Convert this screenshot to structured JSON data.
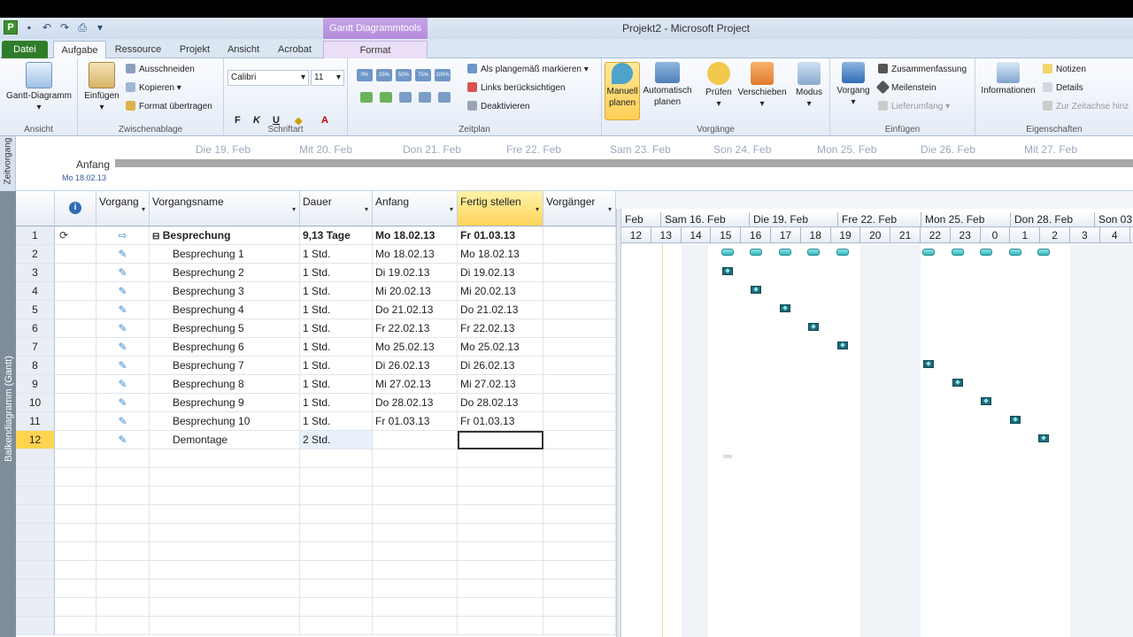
{
  "window": {
    "title": "Projekt2 - Microsoft Project",
    "contextual_tab_group": "Gantt Diagrammtools",
    "app_icon": "P"
  },
  "tabs": [
    "Datei",
    "Aufgabe",
    "Ressource",
    "Projekt",
    "Ansicht",
    "Acrobat",
    "Format"
  ],
  "ribbon": {
    "ansicht": {
      "button": "Gantt-Diagramm",
      "label": "Ansicht"
    },
    "zwischenablage": {
      "einfuegen": "Einfügen",
      "ausschneiden": "Ausschneiden",
      "kopieren": "Kopieren",
      "format": "Format übertragen",
      "label": "Zwischenablage"
    },
    "schriftart": {
      "font": "Calibri",
      "size": "11",
      "label": "Schriftart"
    },
    "zeitplan": {
      "markieren": "Als plangemäß markieren",
      "links": "Links berücksichtigen",
      "deaktivieren": "Deaktivieren",
      "label": "Zeitplan",
      "percent": [
        "0%",
        "25%",
        "50%",
        "75%",
        "100%"
      ]
    },
    "vorgaenge": {
      "manuell": "Manuell planen",
      "automatisch": "Automatisch planen",
      "pruefen": "Prüfen",
      "verschieben": "Verschieben",
      "modus": "Modus",
      "label": "Vorgänge"
    },
    "einfuegen": {
      "vorgang": "Vorgang",
      "zusammenfassung": "Zusammenfassung",
      "meilenstein": "Meilenstein",
      "lieferumfang": "Lieferumfang",
      "label": "Einfügen"
    },
    "eigenschaften": {
      "informationen": "Informationen",
      "notizen": "Notizen",
      "details": "Details",
      "zeitachse": "Zur Zeitachse hinz",
      "label": "Eigenschaften"
    }
  },
  "timeline": {
    "side_label": "Zeitvorgang",
    "dates": [
      "Die 19. Feb",
      "Mit 20. Feb",
      "Don 21. Feb",
      "Fre 22. Feb",
      "Sam 23. Feb",
      "Son 24. Feb",
      "Mon 25. Feb",
      "Die 26. Feb",
      "Mit 27. Feb"
    ],
    "start_label": "Anfang",
    "start_date": "Mo 18.02.13"
  },
  "view_label": "Balkendiagramm (Gantt)",
  "table": {
    "headers": {
      "info": "i",
      "mode": "Vorgang",
      "name": "Vorgangsname",
      "duration": "Dauer",
      "start": "Anfang",
      "finish": "Fertig stellen",
      "pred": "Vorgänger"
    },
    "rows": [
      {
        "id": "1",
        "name": "Besprechung",
        "duration": "9,13 Tage",
        "start": "Mo 18.02.13",
        "finish": "Fr 01.03.13"
      },
      {
        "id": "2",
        "name": "Besprechung 1",
        "duration": "1 Std.",
        "start": "Mo 18.02.13",
        "finish": "Mo 18.02.13"
      },
      {
        "id": "3",
        "name": "Besprechung 2",
        "duration": "1 Std.",
        "start": "Di 19.02.13",
        "finish": "Di 19.02.13"
      },
      {
        "id": "4",
        "name": "Besprechung 3",
        "duration": "1 Std.",
        "start": "Mi 20.02.13",
        "finish": "Mi 20.02.13"
      },
      {
        "id": "5",
        "name": "Besprechung 4",
        "duration": "1 Std.",
        "start": "Do 21.02.13",
        "finish": "Do 21.02.13"
      },
      {
        "id": "6",
        "name": "Besprechung 5",
        "duration": "1 Std.",
        "start": "Fr 22.02.13",
        "finish": "Fr 22.02.13"
      },
      {
        "id": "7",
        "name": "Besprechung 6",
        "duration": "1 Std.",
        "start": "Mo 25.02.13",
        "finish": "Mo 25.02.13"
      },
      {
        "id": "8",
        "name": "Besprechung 7",
        "duration": "1 Std.",
        "start": "Di 26.02.13",
        "finish": "Di 26.02.13"
      },
      {
        "id": "9",
        "name": "Besprechung 8",
        "duration": "1 Std.",
        "start": "Mi 27.02.13",
        "finish": "Mi 27.02.13"
      },
      {
        "id": "10",
        "name": "Besprechung 9",
        "duration": "1 Std.",
        "start": "Do 28.02.13",
        "finish": "Do 28.02.13"
      },
      {
        "id": "11",
        "name": "Besprechung 10",
        "duration": "1 Std.",
        "start": "Fr 01.03.13",
        "finish": "Fr 01.03.13"
      },
      {
        "id": "12",
        "name": "Demontage",
        "duration": "2 Std.",
        "start": "",
        "finish": ""
      }
    ]
  },
  "gantt": {
    "weeks": [
      "Feb",
      "Sam 16. Feb",
      "Die 19. Feb",
      "Fre 22. Feb",
      "Mon 25. Feb",
      "Don 28. Feb",
      "Son 03"
    ],
    "days": [
      "12",
      "13",
      "14",
      "15",
      "16",
      "17",
      "18",
      "19",
      "20",
      "21",
      "22",
      "23",
      "0",
      "1",
      "2",
      "3",
      "4"
    ]
  },
  "colors": {
    "file_tab": "#2f7d2a",
    "selection": "#ffd54f",
    "contextual": "#b48bdc",
    "bar": "#2fb8c0"
  }
}
